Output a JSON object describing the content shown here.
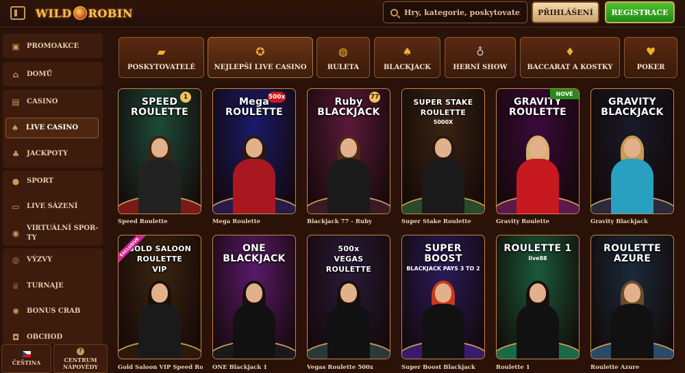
{
  "header": {
    "logo_text_left": "WILD",
    "logo_text_right": "ROBIN",
    "search_placeholder": "Hry, kategorie, poskytovatelé",
    "login_label": "PŘIHLÁŠENÍ",
    "register_label": "REGISTRACE"
  },
  "sidebar": {
    "items": [
      {
        "label": "PROMOAKCE",
        "icon": "gift-icon"
      },
      {
        "label": "DOMŮ",
        "icon": "home-icon"
      },
      {
        "label": "CASINO",
        "icon": "slot-machine-icon"
      },
      {
        "label": "LIVE CASINO",
        "icon": "cards-icon",
        "active": true
      },
      {
        "label": "JACKPOTY",
        "icon": "clover-icon"
      },
      {
        "label": "SPORT",
        "icon": "soccer-ball-icon"
      },
      {
        "label": "LIVE SÁZENÍ",
        "icon": "live-tv-icon"
      },
      {
        "label": "VIRTUÁLNÍ SPORTY",
        "label_line1": "VIRTUÁLNÍ SPOR-",
        "label_line2": "TY",
        "icon": "virtual-sports-icon"
      },
      {
        "label": "VÝZVY",
        "icon": "target-icon"
      },
      {
        "label": "TURNAJE",
        "icon": "trophy-icon"
      },
      {
        "label": "BONUS CRAB",
        "icon": "crab-icon"
      },
      {
        "label": "OBCHOD",
        "icon": "shopping-bag-icon"
      }
    ],
    "language_label": "ČEŠTINA",
    "help_label_line1": "CENTRUM",
    "help_label_line2": "NÁPOVĚDY"
  },
  "categories": [
    {
      "label": "POSKYTOVATELÉ",
      "icon": "book-icon"
    },
    {
      "label": "NEJLEPŠÍ LIVE CASINO",
      "icon": "star-medal-icon",
      "active": true
    },
    {
      "label": "RULETA",
      "icon": "roulette-icon"
    },
    {
      "label": "BLACKJACK",
      "icon": "cards-icon"
    },
    {
      "label": "HERNÍ SHOW",
      "icon": "microphone-icon"
    },
    {
      "label": "BACCARAT A KOSTKY",
      "icon": "cards-dice-icon"
    },
    {
      "label": "POKER",
      "icon": "poker-cards-icon"
    }
  ],
  "games": [
    {
      "caption": "Speed Roulette",
      "title": "SPEED\nROULETTE",
      "badge": "1",
      "bg": "#1d4a3a",
      "table": "#7a1a14",
      "outfit": "#222222",
      "hair": "#3a2414"
    },
    {
      "caption": "Mega Roulette",
      "title": "Mega\nROULETTE",
      "badge": "500x",
      "bg": "#1a1a6a",
      "table": "#2a1a4a",
      "outfit": "#a81820",
      "hair": "#2a1810"
    },
    {
      "caption": "Blackjack 77 - Ruby",
      "title": "Ruby\nBLACKJACK",
      "badge": "77",
      "bg": "#5a1a3a",
      "table": "#3a1a24",
      "outfit": "#1a1a1a",
      "hair": "#4a2c14"
    },
    {
      "caption": "Super Stake Roulette",
      "title": "SUPER STAKE\nROULETTE",
      "sub": "5000X",
      "bg": "#3a2414",
      "table": "#2a4a2a",
      "outfit": "#1a1a1a",
      "hair": "#2a1810"
    },
    {
      "caption": "Gravity Roulette",
      "title": "GRAVITY\nROULETTE",
      "badge": "NOVÉ",
      "bg": "#3a0a3a",
      "table": "#5a1a4a",
      "outfit": "#c81820",
      "hair": "#d8b070"
    },
    {
      "caption": "Gravity Blackjack",
      "title": "GRAVITY\nBLACKJACK",
      "bg": "#1a1a2a",
      "table": "#2a2a3a",
      "outfit": "#2aa0c0",
      "hair": "#c89a50"
    },
    {
      "caption": "Gold Saloon VIP Speed Roulette",
      "title": "GOLD SALOON\nROULETTE\nVIP",
      "badge": "EXCLUSIVE",
      "bg": "#3a2410",
      "table": "#2a1a0a",
      "outfit": "#1a1a1a",
      "hair": "#1a1008"
    },
    {
      "caption": "ONE Blackjack 1",
      "title": "ONE\nBLACKJACK",
      "bg": "#5a1a6a",
      "table": "#1a1a1a",
      "outfit": "#111111",
      "hair": "#1a1008"
    },
    {
      "caption": "Vegas Roulette 500x",
      "title": "500x\nVEGAS\nROULETTE",
      "bg": "#2a1a3a",
      "table": "#2a3a3a",
      "outfit": "#111111",
      "hair": "#1a1008"
    },
    {
      "caption": "Super Boost Blackjack",
      "title": "SUPER\nBOOST",
      "sub": "BLACKJACK PAYS 3 TO 2",
      "bg": "#2a1a5a",
      "table": "#3a1a6a",
      "outfit": "#111111",
      "hair": "#c83a1a"
    },
    {
      "caption": "Roulette 1",
      "title": "ROULETTE 1",
      "sub": "live88",
      "bg": "#1a5a3a",
      "table": "#1a6a4a",
      "outfit": "#111111",
      "hair": "#1a1008"
    },
    {
      "caption": "Roulette Azure",
      "title": "ROULETTE\nAZURE",
      "bg": "#1a2a3a",
      "table": "#2a4a6a",
      "outfit": "#111111",
      "hair": "#6a4a2a"
    }
  ]
}
